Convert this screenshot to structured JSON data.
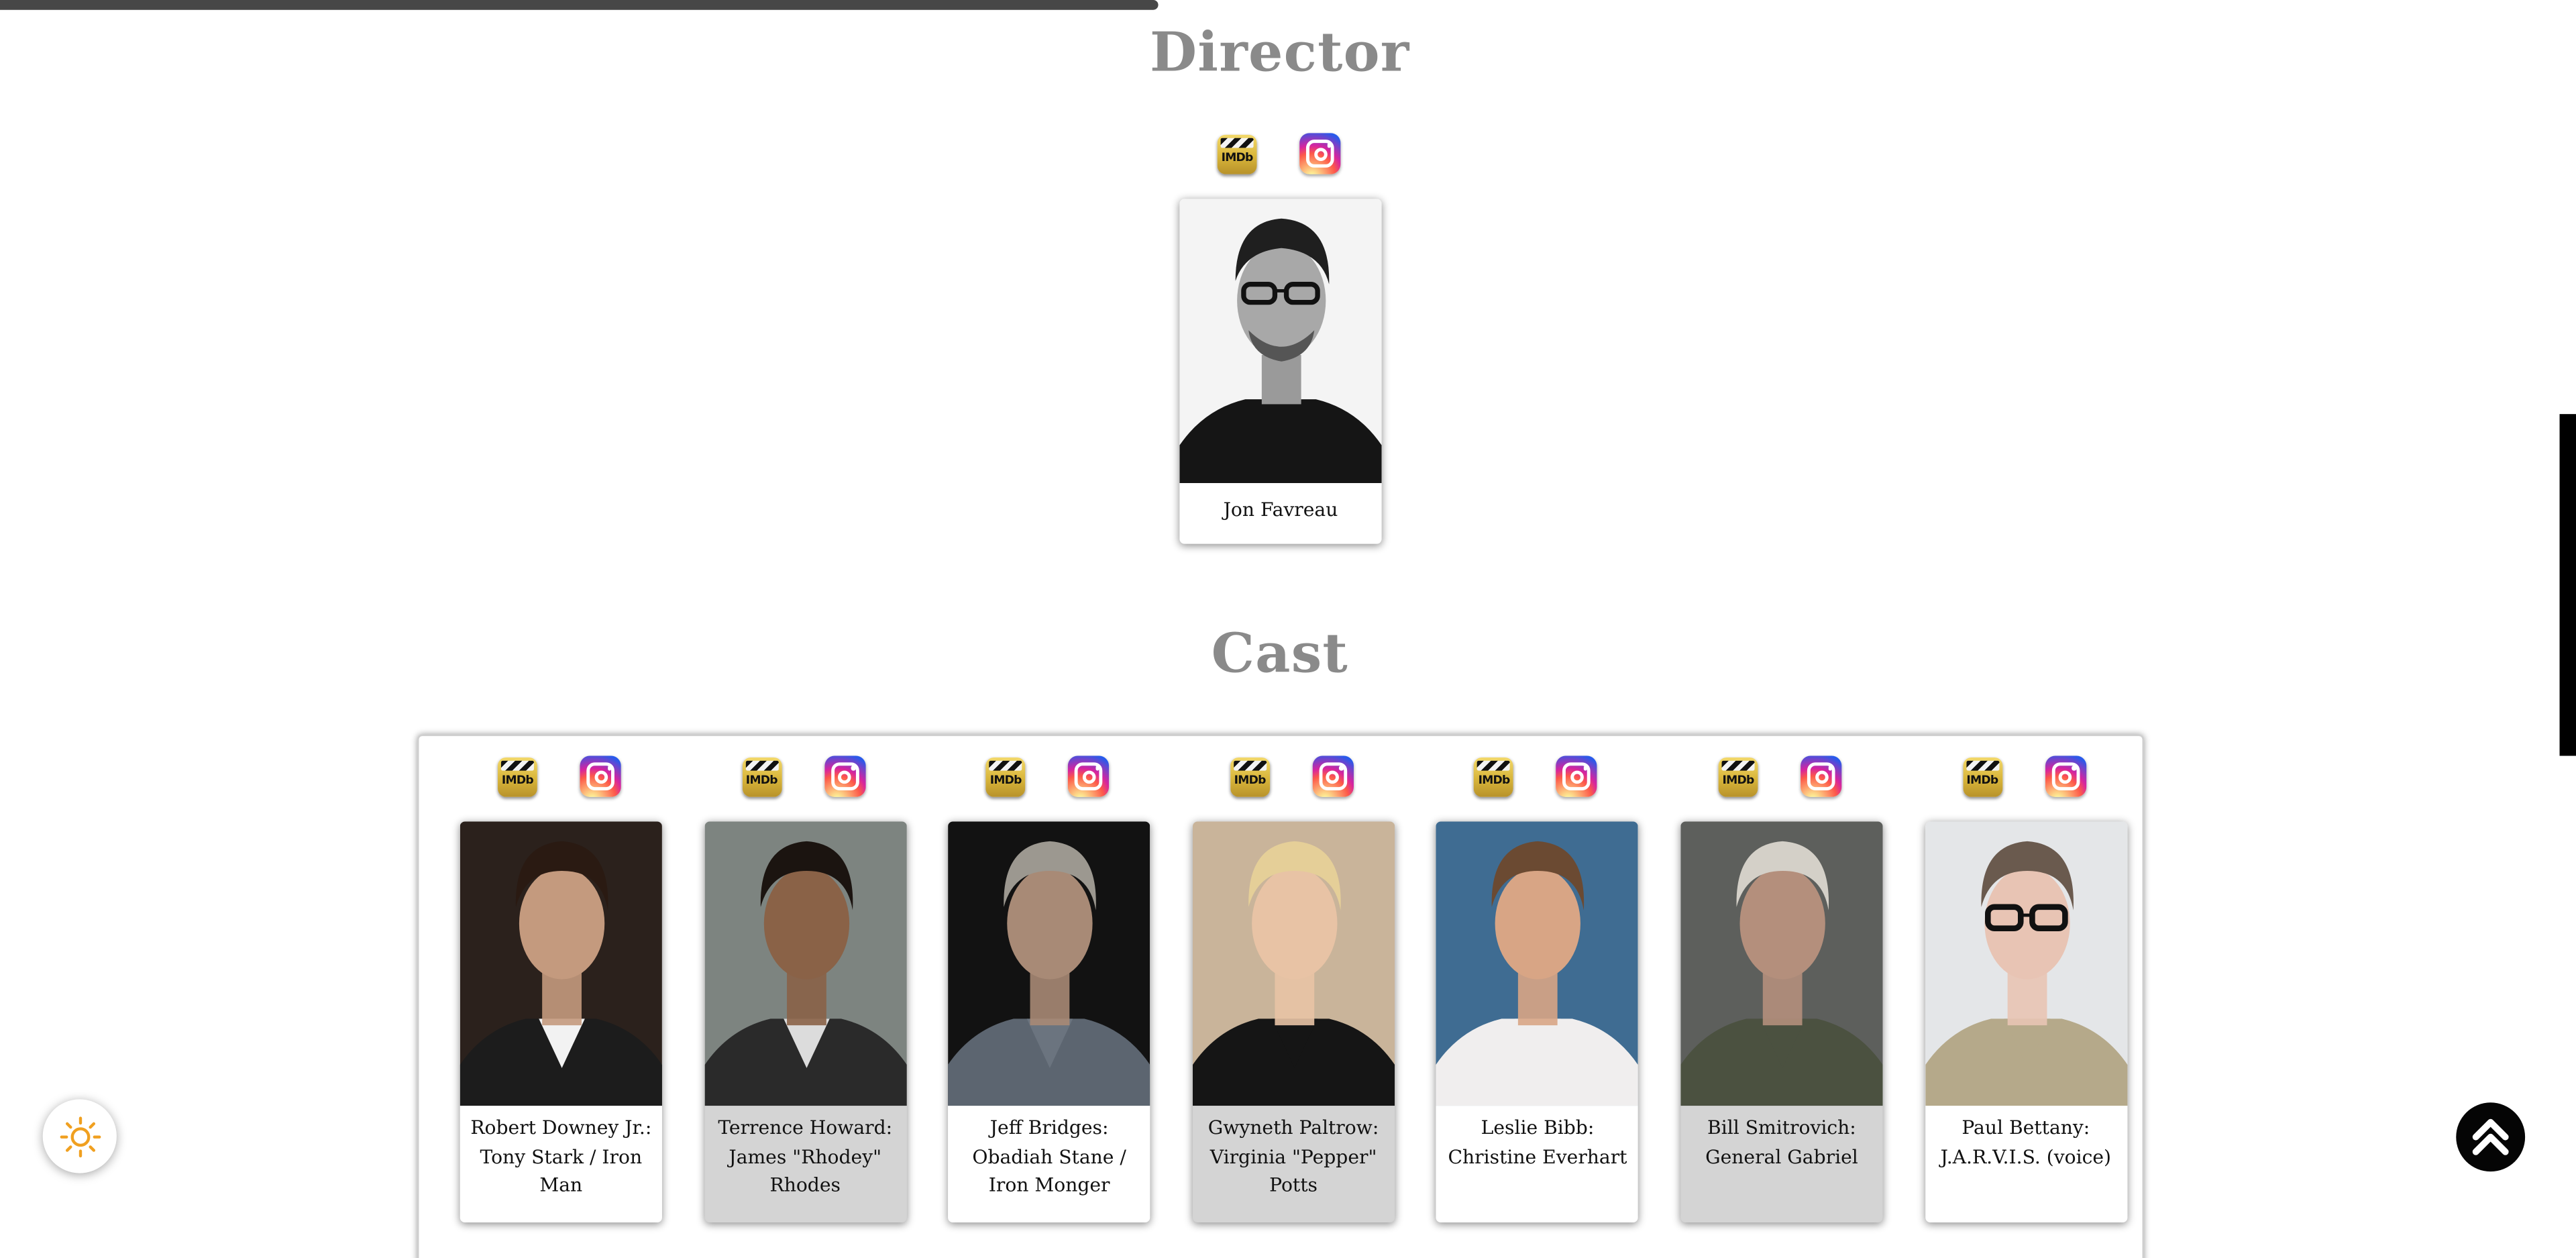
{
  "page": {
    "scroll_progress_percent": 45
  },
  "director": {
    "title": "Director",
    "imdb_label": "IMDb",
    "person": {
      "name": "Jon Favreau"
    }
  },
  "cast": {
    "title": "Cast",
    "imdb_label": "IMDb",
    "members": [
      {
        "name": "Robert Downey Jr.: Tony Stark / Iron Man",
        "card_bg": "#ffffff"
      },
      {
        "name": "Terrence Howard: James \"Rhodey\" Rhodes",
        "card_bg": "#d4d4d4"
      },
      {
        "name": "Jeff Bridges: Obadiah Stane / Iron Monger",
        "card_bg": "#ffffff"
      },
      {
        "name": "Gwyneth Paltrow: Virginia \"Pepper\" Potts",
        "card_bg": "#d4d4d4"
      },
      {
        "name": "Leslie Bibb: Christine Everhart",
        "card_bg": "#ffffff"
      },
      {
        "name": "Bill Smitrovich: General Gabriel",
        "card_bg": "#d4d4d4"
      },
      {
        "name": "Paul Bettany: J.A.R.V.I.S. (voice)",
        "card_bg": "#ffffff"
      }
    ]
  },
  "controls": {
    "theme_icon": "sun-icon",
    "scroll_top_icon": "double-chevron-up-icon"
  },
  "colors": {
    "section_title": "#8a8a8a",
    "progress_bar": "#474747",
    "scroll_top_bg": "#050505",
    "sun": "#f0a020"
  }
}
